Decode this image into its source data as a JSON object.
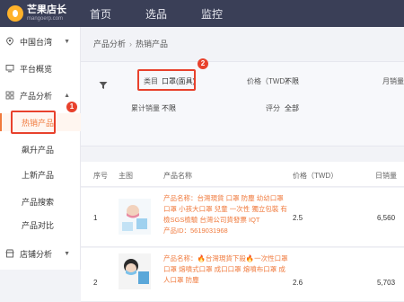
{
  "logo": {
    "name": "芒果店长",
    "sub": "mangoerp.com"
  },
  "nav": [
    "首页",
    "选品",
    "监控"
  ],
  "sidebar": {
    "region": "中国台湾",
    "items": [
      {
        "label": "平台概览"
      },
      {
        "label": "产品分析"
      }
    ],
    "sub_items": [
      "热销产品",
      "飙升产品",
      "上新产品",
      "产品搜索",
      "产品对比"
    ],
    "store": "店铺分析",
    "badge1": "1"
  },
  "breadcrumb": [
    "产品分析",
    "热销产品"
  ],
  "filters": {
    "category_label": "类目",
    "category_value": "口罩(面具)",
    "price_label": "价格（TWD）",
    "price_value": "不限",
    "monthly_label": "月销量",
    "total_label": "累计销量",
    "total_value": "不限",
    "rating_label": "评分",
    "rating_value": "全部",
    "badge2": "2"
  },
  "table": {
    "headers": [
      "序号",
      "主图",
      "产品名称",
      "价格（TWD）",
      "日销量"
    ],
    "rows": [
      {
        "index": "1",
        "line1": "产品名称：台灣現貨 口罩 防塵 幼幼口罩",
        "line2": "口罩 小孩大口罩 兒童 一次性 獨立包裝 有",
        "line3": "檢SGS檢驗 台灣公司貨發票 IQT",
        "line4": "产品ID：5619031968",
        "price": "2.5",
        "daily": "6,560"
      },
      {
        "index": "2",
        "line1": "产品名称：🔥台灣現貨下殺🔥一次性口罩",
        "line2": "口罩 熔噴式口罩 成口口罩 熔噴布口罩 成",
        "line3": "人口罩 防塵",
        "line4": "",
        "price": "2.6",
        "daily": "5,703"
      }
    ]
  }
}
